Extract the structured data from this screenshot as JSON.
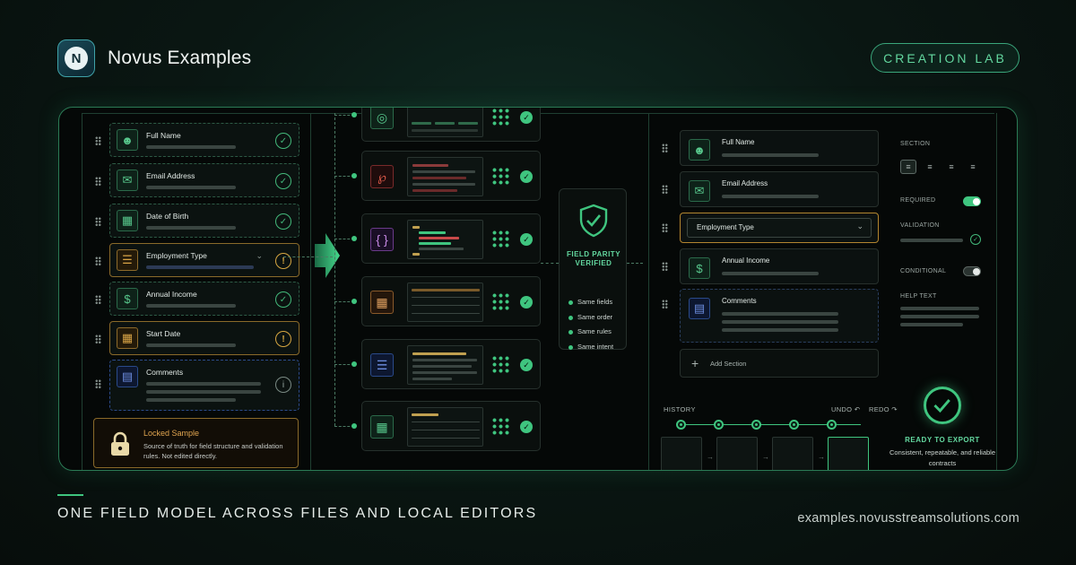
{
  "brand": {
    "name": "Novus Examples",
    "logo_letter": "N"
  },
  "badge": "CREATION LAB",
  "left_form": {
    "fields": [
      {
        "label": "Full Name",
        "icon": "user-icon",
        "status": "ok",
        "style": "green"
      },
      {
        "label": "Email Address",
        "icon": "mail-icon",
        "status": "ok",
        "style": "green"
      },
      {
        "label": "Date of Birth",
        "icon": "calendar-icon",
        "status": "ok",
        "style": "green"
      },
      {
        "label": "Employment Type",
        "icon": "list-icon",
        "status": "warning",
        "style": "warn"
      },
      {
        "label": "Annual Income",
        "icon": "dollar-icon",
        "status": "ok",
        "style": "green"
      },
      {
        "label": "Start Date",
        "icon": "calendar-icon",
        "status": "warning",
        "style": "warn"
      },
      {
        "label": "Comments",
        "icon": "comment-icon",
        "status": "info",
        "style": "blue"
      }
    ],
    "locked": {
      "title": "Locked Sample",
      "description": "Source of truth for field structure and validation rules. Not edited directly."
    }
  },
  "pipeline": {
    "formats": [
      {
        "icon": "globe-icon",
        "color": "green"
      },
      {
        "icon": "pdf-icon",
        "color": "red"
      },
      {
        "icon": "json-braces-icon",
        "color": "purple"
      },
      {
        "icon": "spreadsheet-icon",
        "color": "orange"
      },
      {
        "icon": "document-icon",
        "color": "blue"
      },
      {
        "icon": "table-icon",
        "color": "green"
      }
    ],
    "verification": {
      "title": "FIELD PARITY VERIFIED",
      "checks": [
        "Same fields",
        "Same order",
        "Same rules",
        "Same intent"
      ]
    }
  },
  "editor": {
    "fields": [
      "Full Name",
      "Email Address",
      "Employment Type",
      "Annual Income",
      "Comments"
    ],
    "add_section": "Add Section",
    "properties": {
      "section_label": "SECTION",
      "required_label": "REQUIRED",
      "required_on": true,
      "validation_label": "VALIDATION",
      "conditional_label": "CONDITIONAL",
      "conditional_on": false,
      "help_text_label": "HELP TEXT"
    },
    "history": {
      "label": "HISTORY",
      "undo": "UNDO",
      "redo": "REDO",
      "steps": 5
    },
    "ready": {
      "title": "READY TO EXPORT",
      "description": "Consistent, repeatable, and reliable contracts"
    }
  },
  "colors": {
    "accent": "#3fc57f",
    "warning": "#d6a641",
    "background": "#070d0b"
  },
  "footer": {
    "tagline": "ONE FIELD MODEL ACROSS FILES AND LOCAL EDITORS",
    "url": "examples.novusstreamsolutions.com"
  }
}
